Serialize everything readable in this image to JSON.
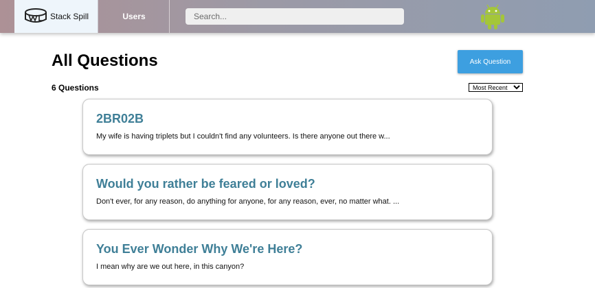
{
  "nav": {
    "brand": "Stack Spill",
    "users_label": "Users",
    "search_placeholder": "Search...",
    "avatar_icon": "android-icon"
  },
  "page": {
    "title": "All Questions",
    "ask_button": "Ask Question",
    "count_label": "6 Questions",
    "sort_selected": "Most Recent"
  },
  "questions": [
    {
      "title": "2BR02B",
      "excerpt": "My wife is having triplets but I couldn't find any volunteers. Is there anyone out there w..."
    },
    {
      "title": "Would you rather be feared or loved?",
      "excerpt": "Don't ever, for any reason, do anything for anyone, for any reason, ever, no matter what. ..."
    },
    {
      "title": "You Ever Wonder Why We're Here?",
      "excerpt": "I mean why are we out here, in this canyon?"
    }
  ],
  "colors": {
    "accent": "#3d9fe0",
    "question_title": "#3f7f97",
    "android": "#a4c639"
  }
}
